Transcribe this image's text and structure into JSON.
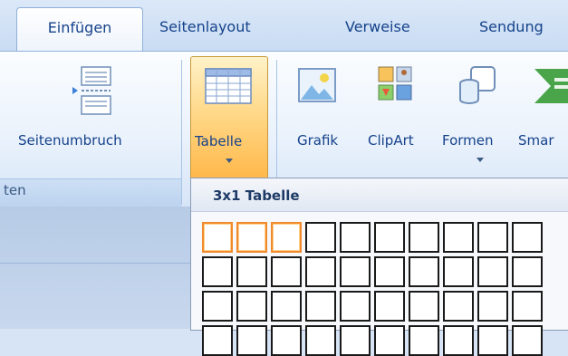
{
  "tabs": {
    "active": "Einfügen",
    "items": [
      "Seitenlayout",
      "Verweise",
      "Sendung"
    ]
  },
  "ribbon": {
    "group_label": "ten",
    "buttons": {
      "seitenumbruch": "Seitenumbruch",
      "tabelle": "Tabelle",
      "grafik": "Grafik",
      "clipart": "ClipArt",
      "formen": "Formen",
      "smartart": "Smar"
    }
  },
  "table_dropdown": {
    "title": "3x1 Tabelle",
    "selected_columns": 3,
    "selected_rows": 1
  },
  "colors": {
    "tab_text": "#15428b",
    "highlight_orange": "#f08a2c"
  }
}
